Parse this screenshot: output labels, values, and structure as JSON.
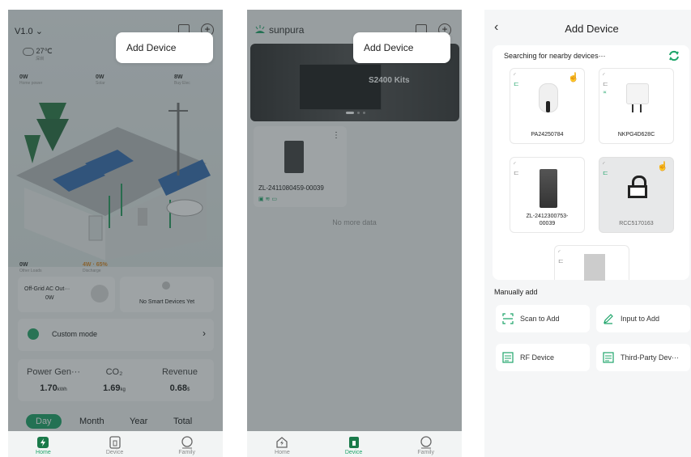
{
  "phone1": {
    "version": "V1.0",
    "weather": {
      "temp": "27℃",
      "sub": "深圳"
    },
    "stats": {
      "home_power": {
        "value": "0W",
        "label": "Home power"
      },
      "solar": {
        "value": "0W",
        "label": "Solar"
      },
      "buy": {
        "value": "8W",
        "label": "Buy Elec"
      },
      "other_loads": {
        "value": "0W",
        "label": "Other Loads"
      },
      "battery": {
        "value": "4W · 65%",
        "label": "Discharge"
      }
    },
    "offgrid": {
      "title": "Off-Grid AC Out···",
      "value": "0W"
    },
    "smart": {
      "label": "No Smart Devices Yet"
    },
    "mode": {
      "label": "Custom mode"
    },
    "summary": [
      {
        "title": "Power Gen···",
        "value": "1.70",
        "unit": "kWh"
      },
      {
        "title": "CO₂",
        "value": "1.69",
        "unit": "kg"
      },
      {
        "title": "Revenue",
        "value": "0.68",
        "unit": "$"
      }
    ],
    "periods": [
      "Day",
      "Month",
      "Year",
      "Total"
    ],
    "popup": "Add Device"
  },
  "phone2": {
    "brand": "sunpura",
    "banner_title": "S2400 Kits",
    "device_name": "ZL-2411080459-00039",
    "no_more": "No more data",
    "popup": "Add Device"
  },
  "phone3": {
    "title": "Add Device",
    "searching": "Searching for nearby devices···",
    "devices": [
      {
        "label": "PA24250784"
      },
      {
        "label": "NKPG4D628C"
      },
      {
        "label": "ZL-2412300753-\n00039"
      },
      {
        "label": "RCC5170163"
      }
    ],
    "manual_title": "Manually add",
    "buttons": {
      "scan": "Scan to Add",
      "input": "Input to Add",
      "rf": "RF Device",
      "third": "Third-Party Dev···"
    }
  },
  "nav": {
    "home": "Home",
    "device": "Device",
    "family": "Family"
  },
  "colors": {
    "accent": "#1fa56a",
    "dark": "#15764a"
  }
}
